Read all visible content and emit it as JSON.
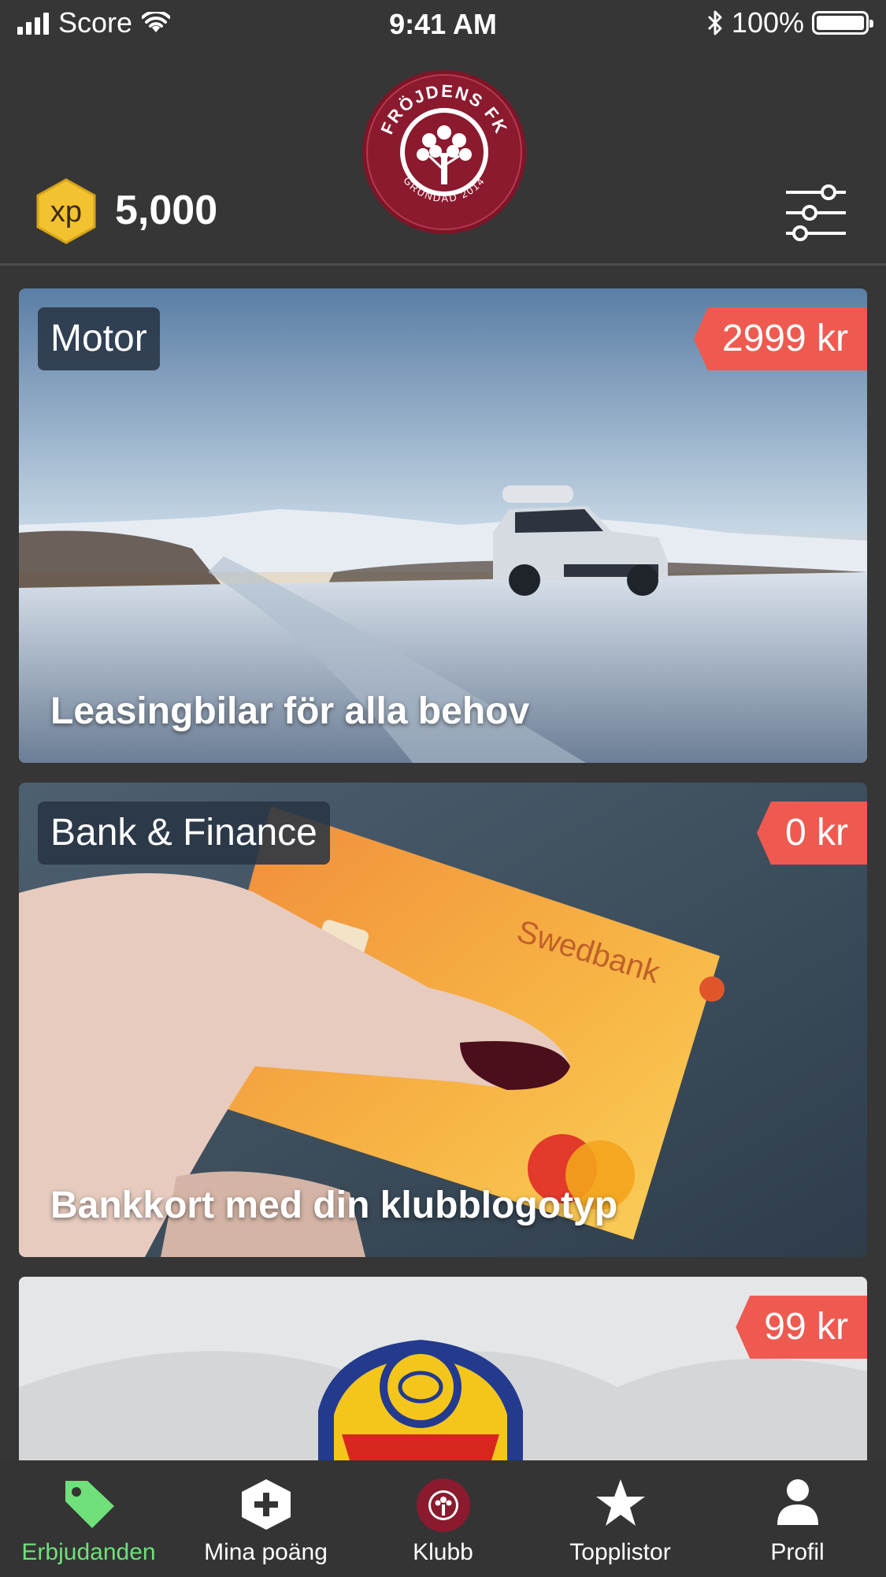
{
  "status_bar": {
    "carrier": "Score",
    "time": "9:41 AM",
    "battery": "100%"
  },
  "header": {
    "xp_badge": "xp",
    "xp_points": "5,000",
    "club_logo_text": {
      "top": "FRÖJDENS FK",
      "bottom": "GRUNDAD 2014"
    }
  },
  "offers": [
    {
      "category": "Motor",
      "price": "2999 kr",
      "title": "Leasingbilar för alla behov"
    },
    {
      "category": "Bank & Finance",
      "price": "0 kr",
      "title": "Bankkort med din klubblogotyp"
    },
    {
      "category": "",
      "price": "99 kr",
      "title": ""
    }
  ],
  "tab_bar": {
    "tabs": [
      {
        "label": "Erbjudanden",
        "icon": "tag-icon",
        "active": true
      },
      {
        "label": "Mina poäng",
        "icon": "plus-hexagon-icon",
        "active": false
      },
      {
        "label": "Klubb",
        "icon": "club-logo-icon",
        "active": false
      },
      {
        "label": "Topplistor",
        "icon": "star-icon",
        "active": false
      },
      {
        "label": "Profil",
        "icon": "person-icon",
        "active": false
      }
    ]
  },
  "colors": {
    "background": "#363636",
    "price_tag": "#ee5a50",
    "active_tab": "#6fe07a",
    "xp_gold": "#f2c230",
    "club_maroon": "#8b1a2f"
  }
}
